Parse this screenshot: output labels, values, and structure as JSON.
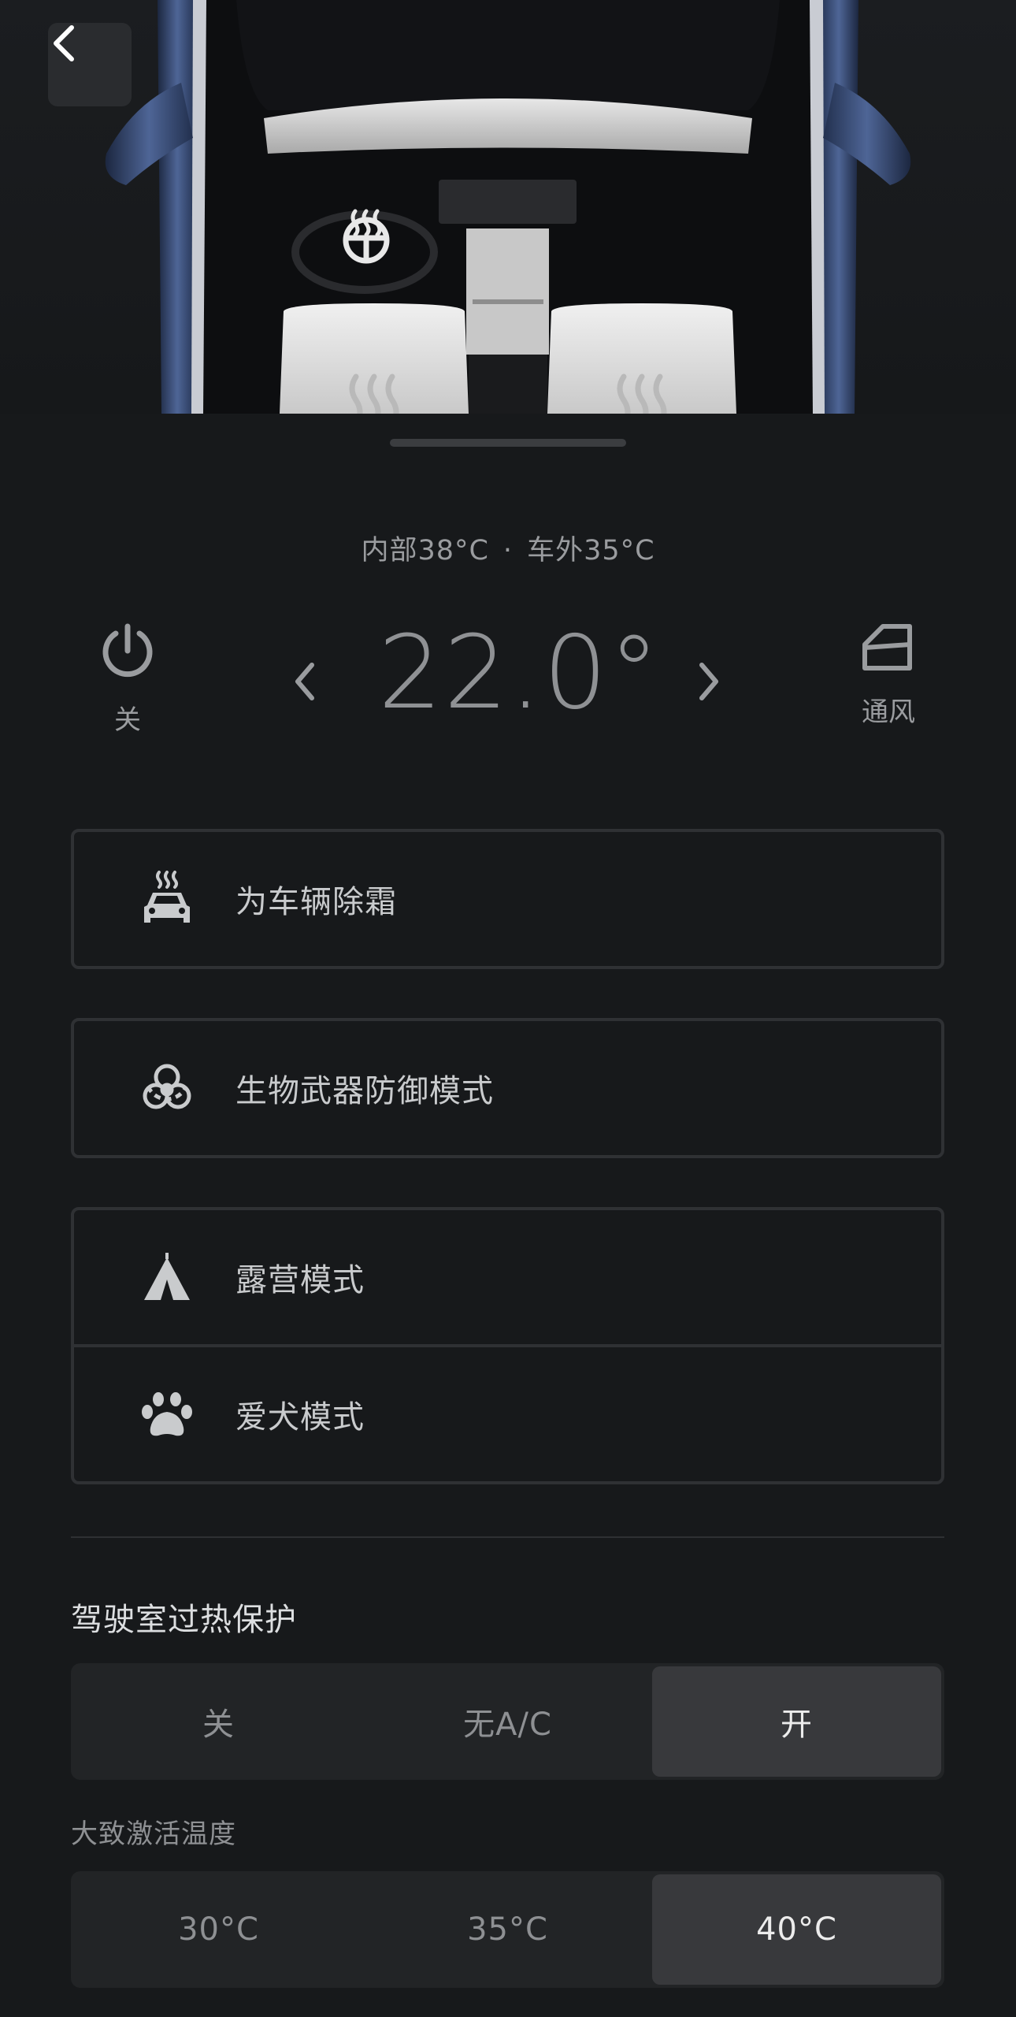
{
  "header": {
    "back_icon": "chevron-left-icon",
    "steering_heat_icon": "heated-steering-wheel-icon",
    "seat_heat_icons": [
      "seat-heat-icon",
      "seat-heat-icon"
    ]
  },
  "climate": {
    "interior_temp": "内部38°C",
    "separator": "·",
    "exterior_temp": "车外35°C",
    "setpoint": "22.0°",
    "power_label": "关",
    "power_icon": "power-icon",
    "vent_label": "通风",
    "vent_icon": "window-vent-icon",
    "decrease_icon": "chevron-left-icon",
    "increase_icon": "chevron-right-icon"
  },
  "modes": [
    {
      "label": "为车辆除霜",
      "icon": "defrost-car-icon"
    },
    {
      "label": "生物武器防御模式",
      "icon": "biohazard-icon"
    },
    {
      "label": "露营模式",
      "icon": "tent-icon"
    },
    {
      "label": "爱犬模式",
      "icon": "paw-icon"
    }
  ],
  "overheat": {
    "title": "驾驶室过热保护",
    "options": [
      "关",
      "无A/C",
      "开"
    ],
    "selected": "开",
    "activation_title": "大致激活温度",
    "temp_options": [
      "30°C",
      "35°C",
      "40°C"
    ],
    "temp_selected": "40°C"
  },
  "colors": {
    "background": "#17191b",
    "car_body": "#3b4f78",
    "active_segment": "#38393c"
  }
}
